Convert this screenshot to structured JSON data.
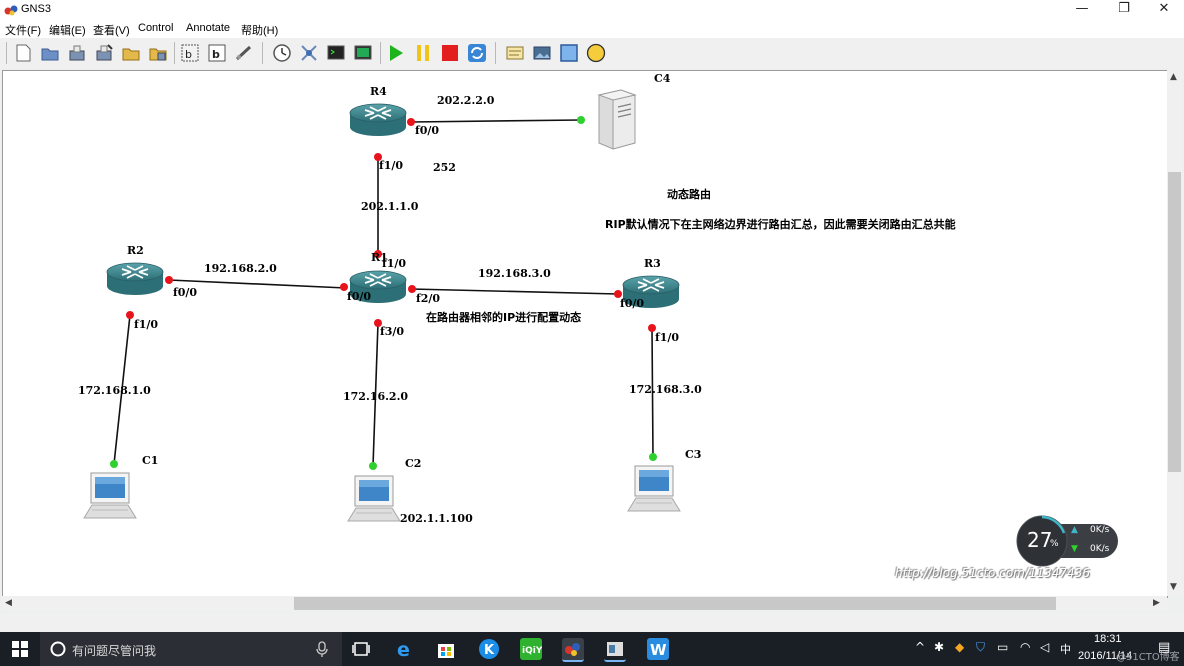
{
  "window": {
    "title": "GNS3",
    "minimize": "—",
    "maximize": "❐",
    "close": "✕"
  },
  "menu": [
    "文件(F)",
    "编辑(E)",
    "查看(V)",
    "Control",
    "Annotate",
    "帮助(H)"
  ],
  "toolbar": {
    "icons": [
      "new-icon",
      "open-icon",
      "save-icon",
      "save-as-icon",
      "open-project-icon",
      "save-project-icon",
      "snapshot-icon",
      "show-interface-labels-icon",
      "console-all-icon",
      "link-icon",
      "clock-icon",
      "capture-icon",
      "terminal-icon",
      "console-icon",
      "start-icon",
      "suspend-icon",
      "stop-icon",
      "reload-icon",
      "add-note-icon",
      "insert-picture-icon",
      "draw-rectangle-icon",
      "draw-ellipse-icon"
    ]
  },
  "topology": {
    "devices": {
      "r1": "R1",
      "r2": "R2",
      "r3": "R3",
      "r4": "R4",
      "c1": "C1",
      "c2": "C2",
      "c3": "C3",
      "c4": "C4"
    },
    "interfaces": {
      "r4_f0_0": "f0/0",
      "r4_f1_0": "f1/0",
      "r1_f1_0": "f1/0",
      "r1_f0_0": "f0/0",
      "r1_f2_0": "f2/0",
      "r1_f3_0": "f3/0",
      "r2_f0_0": "f0/0",
      "r2_f1_0": "f1/0",
      "r3_f0_0": "f0/0",
      "r3_f1_0": "f1/0"
    },
    "networks": {
      "r4_c4": "202.2.2.0",
      "r4_r1": "202.1.1.0",
      "r4_r1_note": "252",
      "r2_r1": "192.168.2.0",
      "r1_r3": "192.168.3.0",
      "r2_c1": "172.168.1.0",
      "r1_c2": "172.16.2.0",
      "r3_c3": "172.168.3.0"
    },
    "c2_ip": "202.1.1.100",
    "notes": {
      "title": "动态路由",
      "rip": "RIP默认情况下在主网络边界进行路由汇总，因此需要关闭路由汇总共能",
      "neighbor": "在路由器相邻的IP进行配置动态"
    },
    "link_color": "#111111",
    "port_down_color": "#e8131b",
    "port_up_color": "#2ed12e",
    "router_color": "#3b8a91"
  },
  "overlay": {
    "cpu_percent": "27",
    "percent_sign": "%",
    "upload": "0K/s",
    "download": "0K/s",
    "watermark": "http://blog.51cto.com/11347436"
  },
  "taskbar": {
    "search_placeholder": "有问题尽管问我",
    "time": "18:31",
    "date": "2016/11/14",
    "ime": "中",
    "tray_overlay": "@51CTO博客"
  }
}
